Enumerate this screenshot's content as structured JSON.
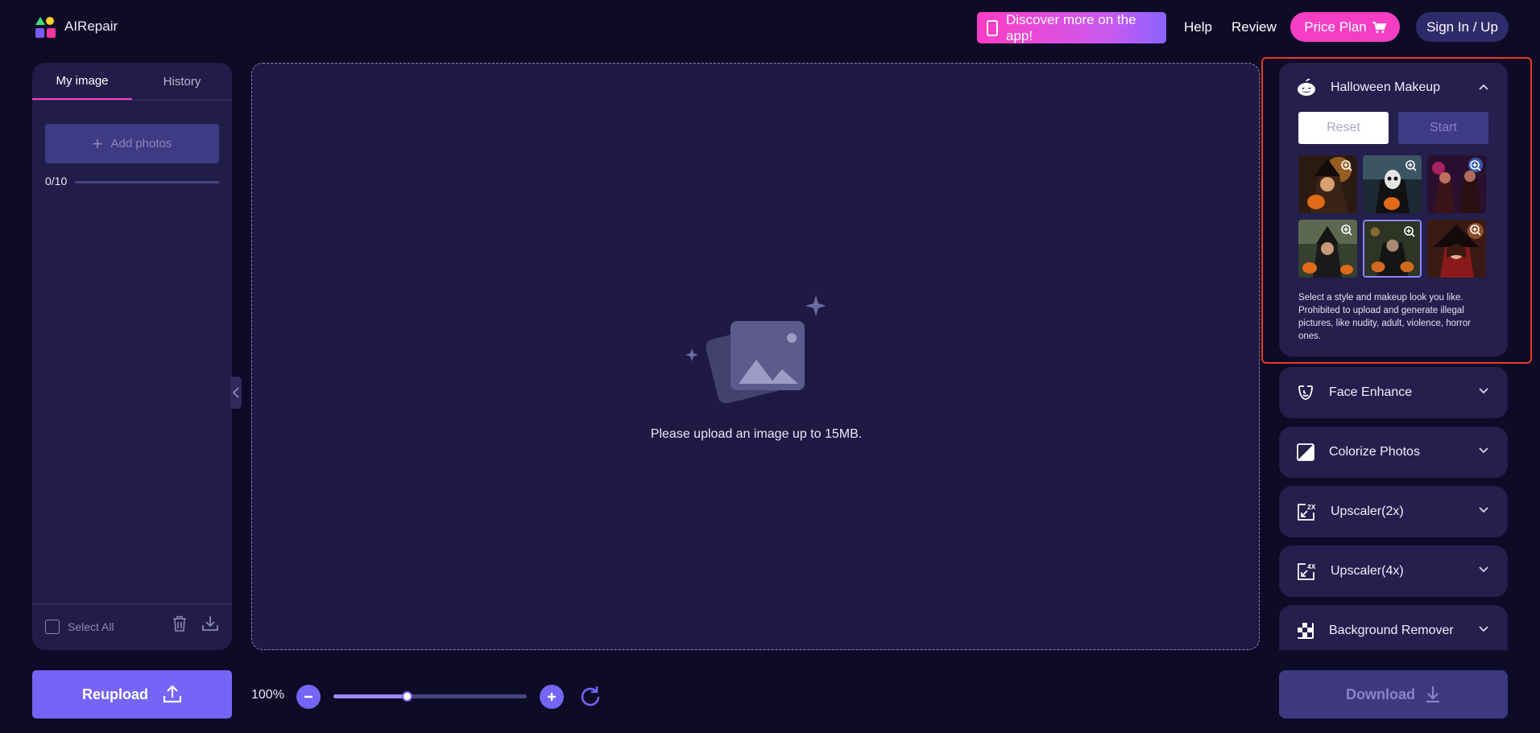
{
  "header": {
    "brand": "AIRepair",
    "discover_label": "Discover more on the app!",
    "help_label": "Help",
    "review_label": "Review",
    "price_label": "Price Plan",
    "signin_label": "Sign In / Up"
  },
  "left_panel": {
    "tab_my_image": "My image",
    "tab_history": "History",
    "add_photos_label": "Add photos",
    "photo_count": "0/10",
    "select_all_label": "Select All"
  },
  "main": {
    "upload_message": "Please upload an image up to 15MB."
  },
  "bottom_bar": {
    "reupload_label": "Reupload",
    "zoom_level": "100%",
    "zoom_slider_fraction": 0.38,
    "download_label": "Download"
  },
  "right_panel": {
    "halloween": {
      "title": "Halloween Makeup",
      "reset_label": "Reset",
      "start_label": "Start",
      "description": "Select a style and makeup look you like. Prohibited to upload and generate illegal pictures, like nudity, adult, violence, horror ones.",
      "selected_index": 4
    },
    "tools": [
      {
        "label": "Face Enhance",
        "icon": "face-enhance-icon"
      },
      {
        "label": "Colorize Photos",
        "icon": "colorize-icon"
      },
      {
        "label": "Upscaler(2x)",
        "icon": "upscale-2x-icon"
      },
      {
        "label": "Upscaler(4x)",
        "icon": "upscale-4x-icon"
      },
      {
        "label": "Background Remover",
        "icon": "background-remover-icon"
      }
    ]
  },
  "colors": {
    "background": "#0d0b26",
    "panel": "#221d48",
    "accent_purple": "#7763f5",
    "accent_pink": "#f43ec3",
    "highlight_red": "#e83a2a"
  }
}
